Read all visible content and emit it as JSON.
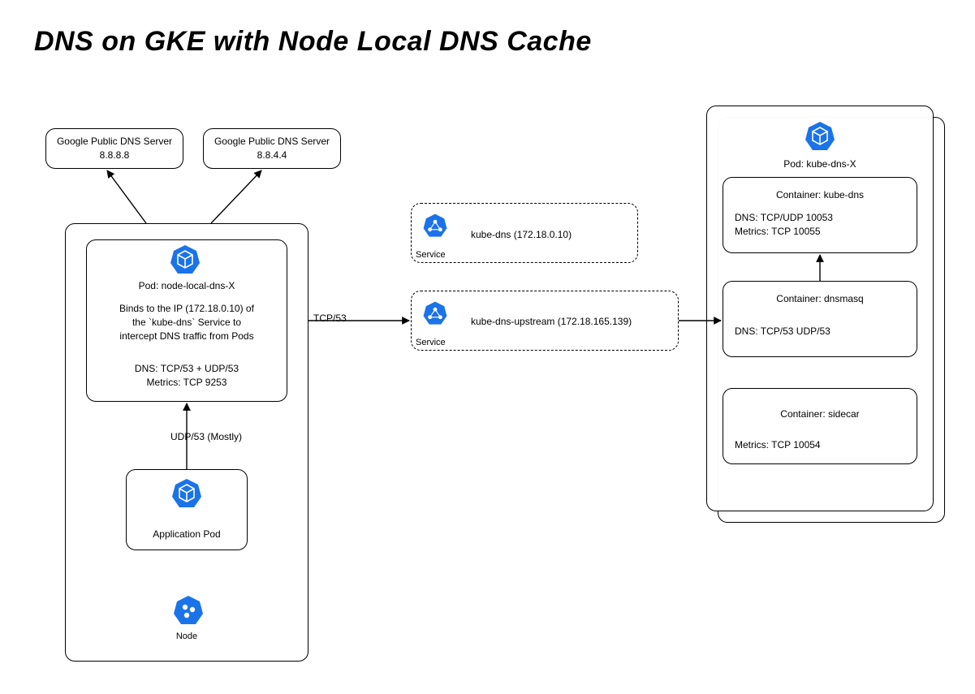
{
  "title": "DNS on GKE with Node Local DNS Cache",
  "dns_servers": {
    "a": {
      "label": "Google Public DNS Server\n8.8.8.8"
    },
    "b": {
      "label": "Google Public DNS Server\n8.8.4.4"
    }
  },
  "node": {
    "icon_label": "Node"
  },
  "node_local_pod": {
    "name": "Pod: node-local-dns-X",
    "desc": "Binds to the IP (172.18.0.10) of\nthe `kube-dns` Service to\nintercept DNS traffic from Pods",
    "ports": "DNS: TCP/53 + UDP/53\nMetrics: TCP 9253"
  },
  "app_pod": {
    "label": "Application Pod"
  },
  "edges": {
    "app_to_local": "UDP/53 (Mostly)",
    "local_to_upstream": "TCP/53"
  },
  "services": {
    "kube_dns": {
      "label": "kube-dns (172.18.0.10)",
      "icon_label": "Service"
    },
    "kube_dns_upstream": {
      "label": "kube-dns-upstream (172.18.165.139)",
      "icon_label": "Service"
    }
  },
  "kube_dns_pod": {
    "name": "Pod: kube-dns-X",
    "containers": {
      "kube_dns": {
        "name": "Container: kube-dns",
        "ports": "DNS: TCP/UDP 10053\nMetrics: TCP 10055"
      },
      "dnsmasq": {
        "name": "Container: dnsmasq",
        "ports": "DNS: TCP/53 UDP/53"
      },
      "sidecar": {
        "name": "Container: sidecar",
        "ports": "Metrics: TCP 10054"
      }
    }
  }
}
